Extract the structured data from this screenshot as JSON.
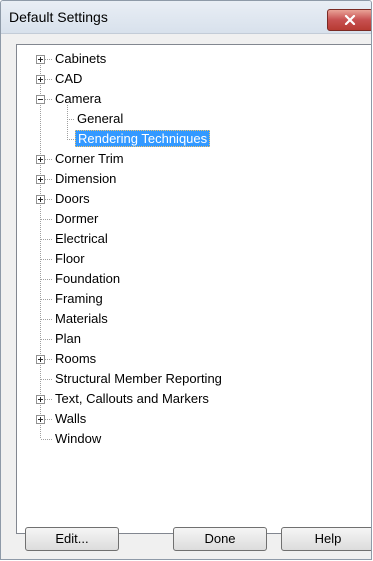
{
  "window": {
    "title": "Default Settings"
  },
  "tree": {
    "items": [
      {
        "label": "Cabinets",
        "expander": "+"
      },
      {
        "label": "CAD",
        "expander": "+"
      },
      {
        "label": "Camera",
        "expander": "-"
      },
      {
        "label": "General",
        "expander": ""
      },
      {
        "label": "Rendering Techniques",
        "expander": "",
        "selected": true
      },
      {
        "label": "Corner Trim",
        "expander": "+"
      },
      {
        "label": "Dimension",
        "expander": "+"
      },
      {
        "label": "Doors",
        "expander": "+"
      },
      {
        "label": "Dormer",
        "expander": ""
      },
      {
        "label": "Electrical",
        "expander": ""
      },
      {
        "label": "Floor",
        "expander": ""
      },
      {
        "label": "Foundation",
        "expander": ""
      },
      {
        "label": "Framing",
        "expander": ""
      },
      {
        "label": "Materials",
        "expander": ""
      },
      {
        "label": "Plan",
        "expander": ""
      },
      {
        "label": "Rooms",
        "expander": "+"
      },
      {
        "label": "Structural Member Reporting",
        "expander": ""
      },
      {
        "label": "Text, Callouts and Markers",
        "expander": "+"
      },
      {
        "label": "Walls",
        "expander": "+"
      },
      {
        "label": "Window",
        "expander": ""
      }
    ]
  },
  "buttons": {
    "edit": "Edit...",
    "done": "Done",
    "help": "Help"
  },
  "colors": {
    "selection": "#3399ff",
    "close": "#c75050"
  }
}
